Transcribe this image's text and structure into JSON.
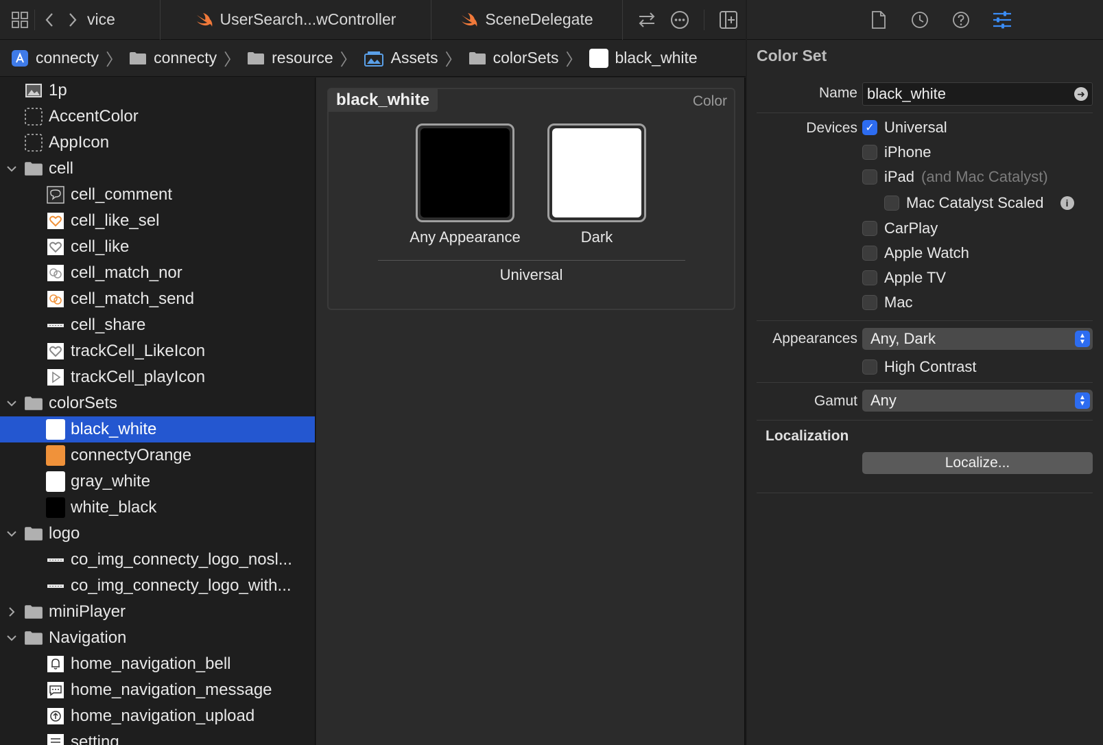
{
  "tabbar": {
    "clipped_tab_label": "vice",
    "tabs": [
      {
        "label": "UserSearch...wController",
        "icon": "swift-file-icon"
      },
      {
        "label": "SceneDelegate",
        "icon": "swift-file-icon"
      }
    ]
  },
  "breadcrumb": [
    {
      "label": "connecty",
      "icon": "project-icon"
    },
    {
      "label": "connecty",
      "icon": "folder-icon"
    },
    {
      "label": "resource",
      "icon": "folder-icon"
    },
    {
      "label": "Assets",
      "icon": "asset-catalog-icon"
    },
    {
      "label": "colorSets",
      "icon": "folder-icon"
    },
    {
      "label": "black_white",
      "icon": "color-swatch-icon"
    }
  ],
  "navigator": {
    "items": [
      {
        "label": "1p",
        "level": 0,
        "icon": "image-set-icon"
      },
      {
        "label": "AccentColor",
        "level": 0,
        "icon": "empty-set-icon"
      },
      {
        "label": "AppIcon",
        "level": 0,
        "icon": "empty-set-icon"
      },
      {
        "label": "cell",
        "level": 0,
        "icon": "folder-icon",
        "expanded": true
      },
      {
        "label": "cell_comment",
        "level": 1,
        "icon": "comment-icon"
      },
      {
        "label": "cell_like_sel",
        "level": 1,
        "icon": "heart-orange-icon"
      },
      {
        "label": "cell_like",
        "level": 1,
        "icon": "heart-icon"
      },
      {
        "label": "cell_match_nor",
        "level": 1,
        "icon": "match-icon"
      },
      {
        "label": "cell_match_send",
        "level": 1,
        "icon": "match-orange-icon"
      },
      {
        "label": "cell_share",
        "level": 1,
        "icon": "share-icon"
      },
      {
        "label": "trackCell_LikeIcon",
        "level": 1,
        "icon": "heart-icon"
      },
      {
        "label": "trackCell_playIcon",
        "level": 1,
        "icon": "play-icon"
      },
      {
        "label": "colorSets",
        "level": 0,
        "icon": "folder-icon",
        "expanded": true
      },
      {
        "label": "black_white",
        "level": 1,
        "icon": "swatch",
        "color": "#ffffff",
        "selected": true
      },
      {
        "label": "connectyOrange",
        "level": 1,
        "icon": "swatch",
        "color": "#f0923a"
      },
      {
        "label": "gray_white",
        "level": 1,
        "icon": "swatch",
        "color": "#ffffff"
      },
      {
        "label": "white_black",
        "level": 1,
        "icon": "swatch",
        "color": "#000000"
      },
      {
        "label": "logo",
        "level": 0,
        "icon": "folder-icon",
        "expanded": true
      },
      {
        "label": "co_img_connecty_logo_nosl...",
        "level": 1,
        "icon": "logo-strip-icon"
      },
      {
        "label": "co_img_connecty_logo_with...",
        "level": 1,
        "icon": "logo-strip-icon"
      },
      {
        "label": "miniPlayer",
        "level": 0,
        "icon": "folder-icon",
        "expanded": false
      },
      {
        "label": "Navigation",
        "level": 0,
        "icon": "folder-icon",
        "expanded": true
      },
      {
        "label": "home_navigation_bell",
        "level": 1,
        "icon": "bell-icon"
      },
      {
        "label": "home_navigation_message",
        "level": 1,
        "icon": "message-icon"
      },
      {
        "label": "home_navigation_upload",
        "level": 1,
        "icon": "upload-icon"
      },
      {
        "label": "setting",
        "level": 1,
        "icon": "list-icon"
      }
    ]
  },
  "editor": {
    "title": "black_white",
    "kind": "Color",
    "wells": [
      {
        "label": "Any Appearance",
        "color": "#000000"
      },
      {
        "label": "Dark",
        "color": "#ffffff"
      }
    ],
    "footer": "Universal"
  },
  "inspector": {
    "title": "Color Set",
    "name_label": "Name",
    "name_value": "black_white",
    "devices_label": "Devices",
    "devices": [
      {
        "label": "Universal",
        "checked": true
      },
      {
        "label": "iPhone",
        "checked": false
      },
      {
        "label": "iPad",
        "hint": "(and Mac Catalyst)",
        "checked": false
      },
      {
        "label": "Mac Catalyst Scaled",
        "checked": false,
        "indent": true,
        "info": true
      },
      {
        "label": "CarPlay",
        "checked": false
      },
      {
        "label": "Apple Watch",
        "checked": false
      },
      {
        "label": "Apple TV",
        "checked": false
      },
      {
        "label": "Mac",
        "checked": false
      }
    ],
    "appearances_label": "Appearances",
    "appearances_value": "Any, Dark",
    "high_contrast_label": "High Contrast",
    "gamut_label": "Gamut",
    "gamut_value": "Any",
    "localization_label": "Localization",
    "localize_button": "Localize..."
  },
  "colors": {
    "accent": "#2d6cf0",
    "selection": "#2457d0",
    "swift_orange": "#f0793a"
  }
}
